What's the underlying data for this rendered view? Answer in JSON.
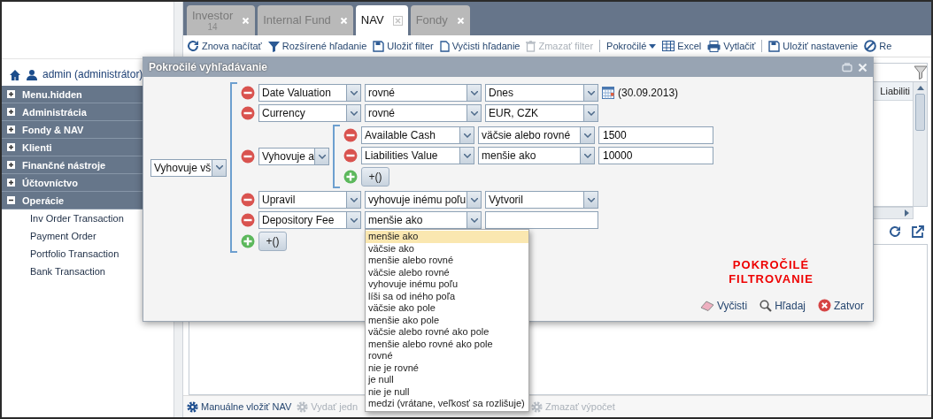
{
  "sidebar": {
    "user": "admin (administrátor)",
    "menu": [
      {
        "label": "Menu.hidden",
        "expanded": false
      },
      {
        "label": "Administrácia",
        "expanded": false
      },
      {
        "label": "Fondy & NAV",
        "expanded": false
      },
      {
        "label": "Klienti",
        "expanded": false
      },
      {
        "label": "Finančné nástroje",
        "expanded": false
      },
      {
        "label": "Účtovníctvo",
        "expanded": false
      },
      {
        "label": "Operácie",
        "expanded": true,
        "children": [
          {
            "label": "Inv Order Transaction"
          },
          {
            "label": "Payment Order"
          },
          {
            "label": "Portfolio Transaction"
          },
          {
            "label": "Bank Transaction"
          }
        ]
      }
    ]
  },
  "tabs": [
    {
      "label": "Investor",
      "badge": "14",
      "selected": false
    },
    {
      "label": "Internal Fund",
      "selected": false
    },
    {
      "label": "NAV",
      "selected": true
    },
    {
      "label": "Fondy",
      "selected": false
    }
  ],
  "toolbar": [
    {
      "kind": "reload",
      "label": "Znova načítať",
      "disabled": false
    },
    {
      "kind": "filter",
      "label": "Rozšírené hľadanie",
      "disabled": false
    },
    {
      "kind": "save",
      "label": "Uložiť filter",
      "disabled": false
    },
    {
      "kind": "clear",
      "label": "Vyčisti hľadanie",
      "disabled": false
    },
    {
      "kind": "delete",
      "label": "Zmazať filter",
      "disabled": true
    },
    {
      "kind": "separator"
    },
    {
      "kind": "menu",
      "label": "Pokročilé",
      "disabled": false
    },
    {
      "kind": "excel",
      "label": "Excel",
      "disabled": false
    },
    {
      "kind": "print",
      "label": "Vytlačiť",
      "disabled": false
    },
    {
      "kind": "separator"
    },
    {
      "kind": "save",
      "label": "Uložiť nastavenie",
      "disabled": false
    },
    {
      "kind": "cancel",
      "label": "Re",
      "disabled": false
    }
  ],
  "grid": {
    "columns": [
      "Liabiliti"
    ]
  },
  "bottom_toolbar": [
    {
      "label": "Manuálne vložiť NAV",
      "disabled": false
    },
    {
      "label": "Vydať jedn",
      "disabled": true
    },
    {
      "label": "Zmazať výpočet",
      "disabled": true
    }
  ],
  "dialog": {
    "title": "Pokročilé vyhľadávanie",
    "filter": {
      "match": "Vyhovuje vš",
      "add_group": "+()",
      "rules": [
        {
          "kind": "condition",
          "field": "Date Valuation",
          "operator": "rovné",
          "value": {
            "kind": "select",
            "text": "Dnes"
          },
          "date": "(30.09.2013)"
        },
        {
          "kind": "condition",
          "field": "Currency",
          "operator": "rovné",
          "value": {
            "kind": "select",
            "text": "EUR, CZK"
          }
        },
        {
          "kind": "group",
          "match": "Vyhovuje a",
          "add_group": "+()",
          "rules": [
            {
              "kind": "condition",
              "field": "Available Cash",
              "operator": "väčsie alebo rovné",
              "value": {
                "kind": "input",
                "text": "1500"
              }
            },
            {
              "kind": "condition",
              "field": "Liabilities Value",
              "operator": "menšie ako",
              "value": {
                "kind": "input",
                "text": "10000"
              }
            }
          ]
        },
        {
          "kind": "condition",
          "field": "Upravil",
          "operator": "vyhovuje inému poľu",
          "value": {
            "kind": "select",
            "text": "Vytvoril"
          }
        },
        {
          "kind": "condition",
          "field": "Depository Fee",
          "operator": "menšie ako",
          "value": {
            "kind": "input"
          },
          "operator_options": [
            {
              "label": "menšie ako",
              "selected": true
            },
            {
              "label": "väčsie ako",
              "selected": false
            },
            {
              "label": "menšie alebo rovné",
              "selected": false
            },
            {
              "label": "väčsie alebo rovné",
              "selected": false
            },
            {
              "label": "vyhovuje inému poľu",
              "selected": false
            },
            {
              "label": "líši sa od iného poľa",
              "selected": false
            },
            {
              "label": "väčsie ako pole",
              "selected": false
            },
            {
              "label": "menšie ako pole",
              "selected": false
            },
            {
              "label": "väčsie alebo rovné ako pole",
              "selected": false
            },
            {
              "label": "menšie alebo rovné ako pole",
              "selected": false
            },
            {
              "label": "rovné",
              "selected": false
            },
            {
              "label": "nie je rovné",
              "selected": false
            },
            {
              "label": "je null",
              "selected": false
            },
            {
              "label": "nie je null",
              "selected": false
            },
            {
              "label": "medzi (vrátane, veľkosť sa rozlišuje)",
              "selected": false
            }
          ]
        }
      ]
    },
    "annotation": "POKROČILÉ FILTROVANIE",
    "buttons": [
      {
        "kind": "clear",
        "label": "Vyčisti"
      },
      {
        "kind": "search",
        "label": "Hľadaj"
      },
      {
        "kind": "close",
        "label": "Zatvor"
      }
    ]
  }
}
